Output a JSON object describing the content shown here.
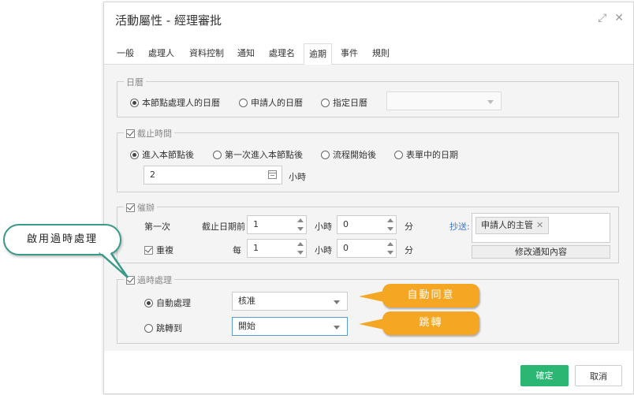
{
  "dialog": {
    "title": "活動屬性 - 經理審批",
    "expand_icon": "expand-icon",
    "close_icon": "close-icon"
  },
  "tabs": [
    "一般",
    "處理人",
    "資料控制",
    "通知",
    "處理名",
    "逾期",
    "事件",
    "規則"
  ],
  "active_tab": "逾期",
  "calendar": {
    "legend": "日曆",
    "options": [
      "本節點處理人的日曆",
      "申請人的日曆",
      "指定日曆"
    ],
    "selected": "本節點處理人的日曆",
    "specified_value": ""
  },
  "deadline": {
    "legend": "截止時間",
    "checked": true,
    "options": [
      "進入本節點後",
      "第一次進入本節點後",
      "流程開始後",
      "表單中的日期"
    ],
    "selected": "進入本節點後",
    "value": "2",
    "unit": "小時"
  },
  "reminder": {
    "legend": "催辦",
    "checked": true,
    "first_label": "第一次",
    "before_label": "截止日期前",
    "first_hours": "1",
    "first_minutes": "0",
    "repeat_label": "重複",
    "repeat_checked": true,
    "every_label": "每",
    "repeat_hours": "1",
    "repeat_minutes": "0",
    "hour_unit": "小時",
    "minute_unit": "分",
    "cc_label": "抄送:",
    "cc_tag": "申請人的主管",
    "edit_notice_label": "修改通知內容"
  },
  "overdue": {
    "legend": "過時處理",
    "checked": true,
    "options": [
      "自動處理",
      "跳轉到"
    ],
    "selected": "自動處理",
    "auto_value": "核准",
    "jump_value": "開始"
  },
  "buttons": {
    "ok": "確定",
    "cancel": "取消"
  },
  "annotations": {
    "bubble": "啟用過時處理",
    "callout_auto": "自動同意",
    "callout_jump": "跳轉"
  },
  "colors": {
    "ok_button": "#2bb673",
    "callout": "#f5a623",
    "bubble_border": "#3a9a8a"
  }
}
